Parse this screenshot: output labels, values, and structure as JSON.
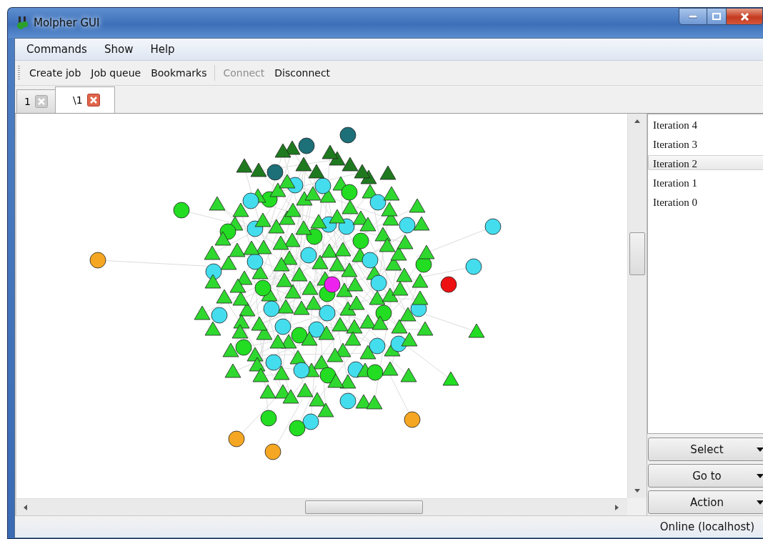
{
  "window": {
    "title": "Molpher GUI"
  },
  "menu": [
    "Commands",
    "Show",
    "Help"
  ],
  "toolbar": [
    {
      "label": "Create job",
      "disabled": false
    },
    {
      "label": "Job queue",
      "disabled": false
    },
    {
      "label": "Bookmarks",
      "disabled": false
    },
    {
      "label": "Connect",
      "disabled": true,
      "separator_before": true
    },
    {
      "label": "Disconnect",
      "disabled": false
    }
  ],
  "tabs": [
    {
      "label": "1",
      "selected": false
    },
    {
      "label": "\\1",
      "selected": true
    }
  ],
  "iterations": [
    {
      "label": "Iteration 4",
      "selected": false
    },
    {
      "label": "Iteration 3",
      "selected": false
    },
    {
      "label": "Iteration 2",
      "selected": true
    },
    {
      "label": "Iteration 1",
      "selected": false
    },
    {
      "label": "Iteration 0",
      "selected": false
    }
  ],
  "buttons": [
    "Select",
    "Go to",
    "Action"
  ],
  "status_bar": "Online (localhost)"
}
